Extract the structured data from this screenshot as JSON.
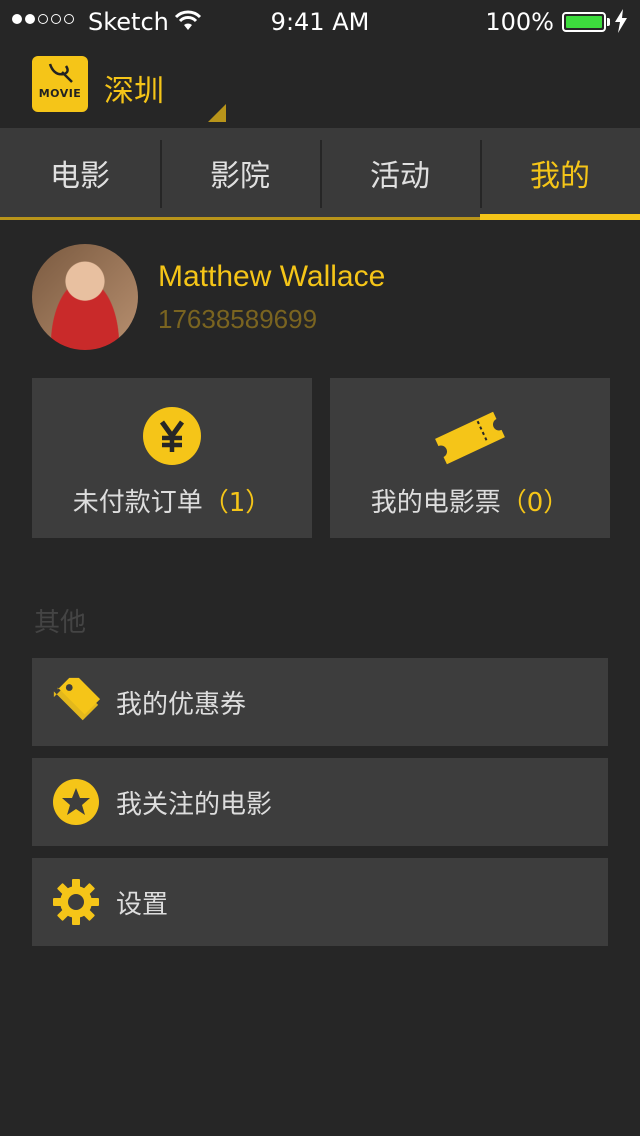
{
  "status_bar": {
    "carrier": "Sketch",
    "time": "9:41 AM",
    "battery": "100%"
  },
  "header": {
    "logo_text": "MOVIE",
    "city": "深圳"
  },
  "tabs": [
    {
      "label": "电影"
    },
    {
      "label": "影院"
    },
    {
      "label": "活动"
    },
    {
      "label": "我的"
    }
  ],
  "profile": {
    "name": "Matthew Wallace",
    "phone": "17638589699"
  },
  "cards": {
    "orders": {
      "label": "未付款订单",
      "count": "（1）"
    },
    "tickets": {
      "label": "我的电影票",
      "count": "（0）"
    }
  },
  "section": {
    "title": "其他"
  },
  "menu": {
    "coupons": "我的优惠券",
    "followed": "我关注的电影",
    "settings": "设置"
  },
  "colors": {
    "accent": "#f5c518",
    "background": "#262626",
    "panel": "#3d3d3d"
  }
}
